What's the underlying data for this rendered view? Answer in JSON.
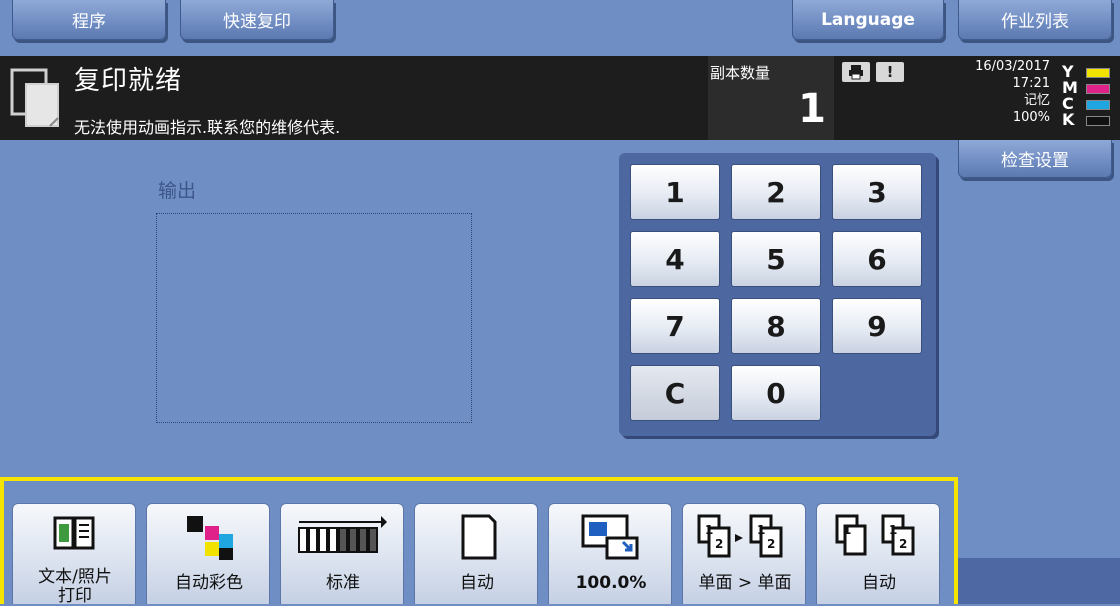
{
  "tabs": {
    "program": "程序",
    "quick_copy": "快速复印",
    "language": "Language",
    "job_list": "作业列表"
  },
  "status": {
    "title": "复印就绪",
    "message": "无法使用动画指示.联系您的维修代表.",
    "copies_label": "副本数量",
    "copies_value": "1",
    "indicator_alert": "!",
    "date": "16/03/2017",
    "time": "17:21",
    "memory_label": "记忆",
    "memory_value": "100%",
    "toner": [
      {
        "letter": "Y",
        "color": "#f2e200"
      },
      {
        "letter": "M",
        "color": "#e0218a"
      },
      {
        "letter": "C",
        "color": "#1fa6e0"
      },
      {
        "letter": "K",
        "color": "#111111"
      }
    ]
  },
  "check_settings": "检查设置",
  "output": {
    "label": "输出"
  },
  "keypad": [
    "1",
    "2",
    "3",
    "4",
    "5",
    "6",
    "7",
    "8",
    "9",
    "C",
    "0"
  ],
  "functions": [
    {
      "label": "文本/照片\n打印",
      "icon": "text-photo-icon"
    },
    {
      "label": "自动彩色",
      "icon": "auto-color-icon"
    },
    {
      "label": "标准",
      "icon": "density-icon"
    },
    {
      "label": "自动",
      "icon": "paper-icon"
    },
    {
      "label": "100.0%",
      "icon": "zoom-icon"
    },
    {
      "label": "单面 > 单面",
      "icon": "duplex-icon"
    },
    {
      "label": "自动",
      "icon": "finishing-icon"
    }
  ],
  "colors": {
    "background": "#6f8fc4",
    "highlight": "#f5e400",
    "statusbar": "#1d1d1d"
  }
}
